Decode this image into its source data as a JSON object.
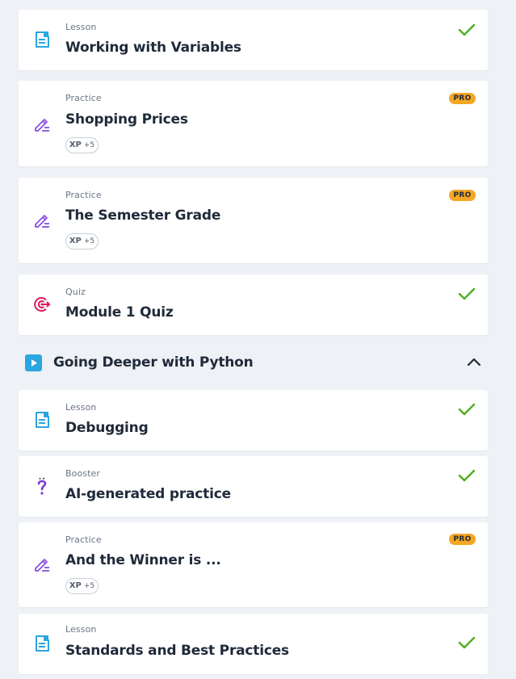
{
  "items_top": [
    {
      "kind": "Lesson",
      "title": "Working with Variables",
      "status": "completed",
      "icon": "lesson-icon"
    },
    {
      "kind": "Practice",
      "title": "Shopping Prices",
      "badge": "PRO",
      "xp_label": "XP",
      "xp_value": "+5",
      "icon": "pencil-icon"
    },
    {
      "kind": "Practice",
      "title": "The Semester Grade",
      "badge": "PRO",
      "xp_label": "XP",
      "xp_value": "+5",
      "icon": "pencil-icon"
    },
    {
      "kind": "Quiz",
      "title": "Module 1 Quiz",
      "status": "completed",
      "icon": "target-icon"
    }
  ],
  "section": {
    "title": "Going Deeper with Python",
    "icon": "play-icon",
    "expanded": true
  },
  "items_bottom": [
    {
      "kind": "Lesson",
      "title": "Debugging",
      "status": "completed",
      "icon": "lesson-icon"
    },
    {
      "kind": "Booster",
      "title": "AI-generated practice",
      "status": "completed",
      "icon": "question-mark-icon"
    },
    {
      "kind": "Practice",
      "title": "And the Winner is ...",
      "badge": "PRO",
      "xp_label": "XP",
      "xp_value": "+5",
      "icon": "pencil-icon"
    },
    {
      "kind": "Lesson",
      "title": "Standards and Best Practices",
      "status": "completed",
      "icon": "lesson-icon"
    }
  ],
  "colors": {
    "background": "#eef1f5",
    "card": "#ffffff",
    "check": "#4caf1c",
    "pro_badge": "#f5a623",
    "lesson_icon": "#2aa6e0",
    "practice_icon": "#8a4fe0",
    "quiz_icon": "#e0175f",
    "booster_icon": "#7a3ccf"
  }
}
